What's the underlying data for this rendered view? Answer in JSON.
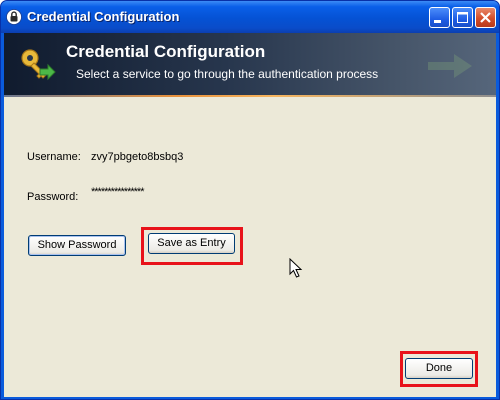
{
  "window": {
    "title": "Credential Configuration",
    "controls": [
      "minimize-icon",
      "maximize-icon",
      "close-icon"
    ]
  },
  "header": {
    "title": "Credential Configuration",
    "subtitle": "Select a service to go through the authentication process",
    "icon": "key-icon"
  },
  "form": {
    "username_label": "Username:",
    "username_value": "zvy7pbgeto8bsbq3",
    "password_label": "Password:",
    "password_value": "****************"
  },
  "buttons": {
    "show_password": "Show Password",
    "save_as_entry": "Save as Entry",
    "done": "Done"
  },
  "colors": {
    "titlebar": "#0A5FE8",
    "dialog_background": "#ECE9D8",
    "highlight": "#E8121A"
  }
}
